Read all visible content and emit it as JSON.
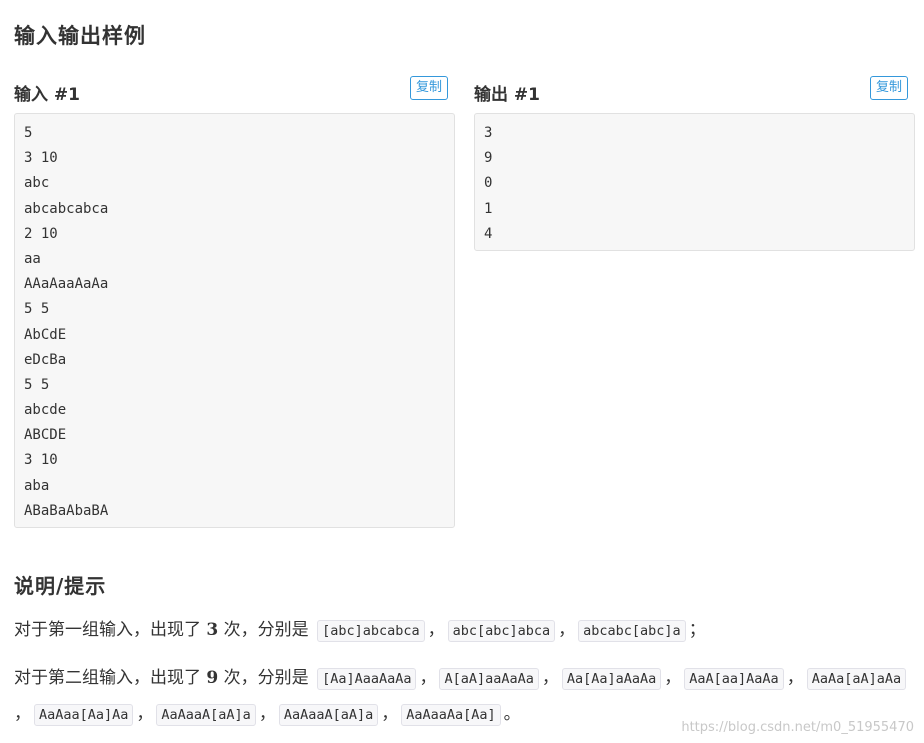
{
  "section_title": "输入输出样例",
  "input": {
    "heading": "输入 #1",
    "copy_label": "复制",
    "lines": [
      "5",
      "3 10",
      "abc",
      "abcabcabca",
      "2 10",
      "aa",
      "AAaAaaAaAa",
      "5 5",
      "AbCdE",
      "eDcBa",
      "5 5",
      "abcde",
      "ABCDE",
      "3 10",
      "aba",
      "ABaBaAbaBA"
    ]
  },
  "output": {
    "heading": "输出 #1",
    "copy_label": "复制",
    "lines": [
      "3",
      "9",
      "0",
      "1",
      "4"
    ]
  },
  "hint": {
    "title": "说明/提示",
    "para1": {
      "prefix": "对于第一组输入，出现了",
      "count": "3",
      "mid": "次，分别是",
      "items": [
        "[abc]abcabca",
        "abc[abc]abca",
        "abcabc[abc]a"
      ],
      "end": "；"
    },
    "para2": {
      "prefix": "对于第二组输入，出现了",
      "count": "9",
      "mid": "次，分别是",
      "items": [
        "[Aa]AaaAaAa",
        "A[aA]aaAaAa",
        "Aa[Aa]aAaAa",
        "AaA[aa]AaAa",
        "AaAa[aA]aAa",
        "AaAaa[Aa]Aa",
        "AaAaaA[aA]a",
        "AaAaaA[aA]a",
        "AaAaaAa[Aa]"
      ],
      "end": "。"
    }
  },
  "watermark": "https://blog.csdn.net/m0_51955470"
}
